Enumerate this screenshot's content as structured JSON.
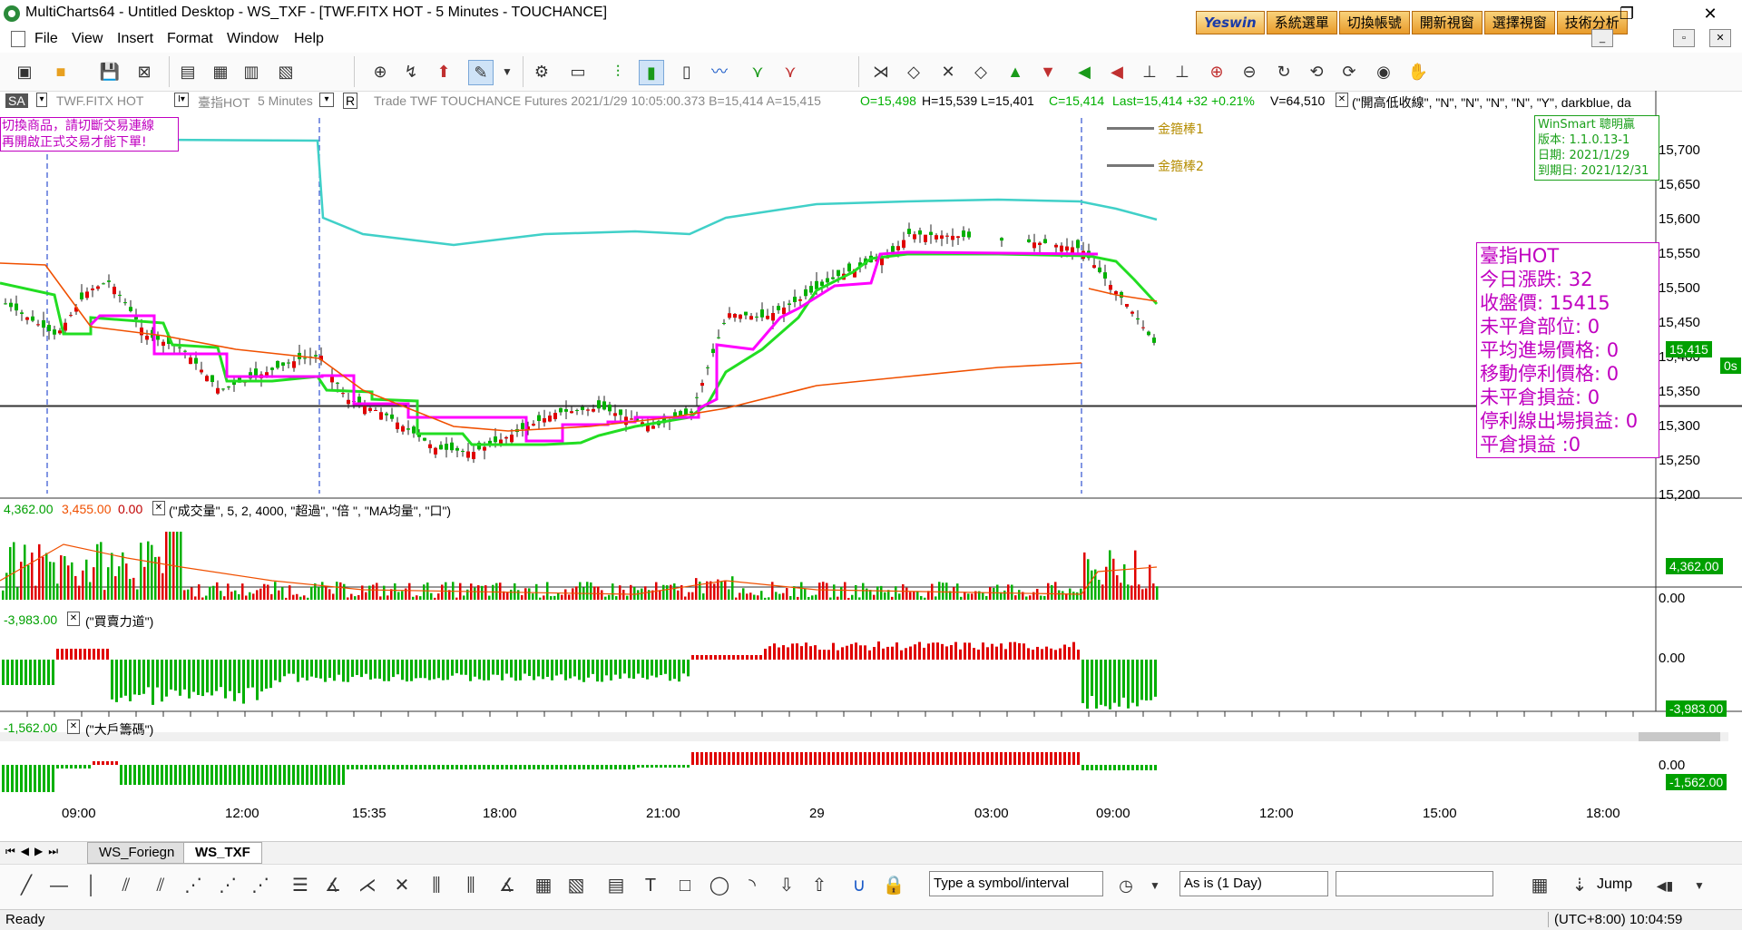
{
  "window": {
    "title": "MultiCharts64 - Untitled Desktop - WS_TXF - [TWF.FITX HOT - 5 Minutes - TOUCHANCE]",
    "min": "─",
    "restore": "❐",
    "close": "✕"
  },
  "yeswin": {
    "logo": "Yeswin",
    "buttons": [
      "系統選單",
      "切換帳號",
      "開新視窗",
      "選擇視窗",
      "技術分析"
    ]
  },
  "menu": [
    "File",
    "View",
    "Insert",
    "Format",
    "Window",
    "Help"
  ],
  "chart_header": {
    "sa": "SA",
    "symbol": "TWF.FITX HOT",
    "name": "臺指HOT",
    "interval": "5 Minutes",
    "mode": "R",
    "text": "Trade  TWF  TOUCHANCE  Futures  2021/1/29  10:05:00.373  B=15,414  A=15,415",
    "o": "O=15,498",
    "hl": "H=15,539  L=15,401",
    "c": "C=15,414",
    "last": "Last=15,414  +32  +0.21%",
    "v": "V=64,510",
    "study": "(\"開高低收線\", \"N\", \"N\", \"N\", \"N\", \"Y\", darkblue, da"
  },
  "notice": [
    "切換商品，請切斷交易連線",
    "再開啟正式交易才能下單!"
  ],
  "legend": [
    "金箍棒1",
    "金箍棒2"
  ],
  "winsmart": [
    "WinSmart 聰明贏",
    "版本: 1.1.0.13-1",
    "日期: 2021/1/29",
    "到期日: 2021/12/31"
  ],
  "infobox": [
    "臺指HOT",
    "今日漲跌: 32",
    "收盤價: 15415",
    "未平倉部位: 0",
    "平均進場價格: 0",
    "移動停利價格: 0",
    "未平倉損益: 0",
    "停利線出場損益: 0",
    "平倉損益 :0"
  ],
  "price_axis": [
    "15,700",
    "15,650",
    "15,600",
    "15,550",
    "15,500",
    "15,450",
    "15,400",
    "15,350",
    "15,300",
    "15,250",
    "15,200"
  ],
  "price_tag": "15,415",
  "price_tag2": "0s",
  "panel2": {
    "vals": [
      "4,362.00",
      "3,455.00",
      "0.00"
    ],
    "study": "(\"成交量\",  5,  2,  4000,  \"超過\",  \"倍 \",  \"MA均量\",  \"口\")",
    "axis": "0.00",
    "tag": "4,362.00"
  },
  "panel3": {
    "val": "-3,983.00",
    "study": "(\"買賣力道\")",
    "axis": "0.00",
    "tag": "-3,983.00"
  },
  "panel4": {
    "val": "-1,562.00",
    "study": "(\"大戶籌碼\")",
    "axis": "0.00",
    "tag": "-1,562.00"
  },
  "time_axis": [
    "09:00",
    "12:00",
    "15:35",
    "18:00",
    "21:00",
    "29",
    "03:00",
    "09:00",
    "12:00",
    "15:00",
    "18:00"
  ],
  "tabs": [
    "WS_Foriegn",
    "WS_TXF"
  ],
  "drawbar": {
    "symbol_input": "Type a symbol/interval",
    "resolution": "As is (1 Day)",
    "jump": "Jump"
  },
  "status": {
    "ready": "Ready",
    "time": "(UTC+8:00) 10:04:59"
  },
  "colors": {
    "green": "#00b000",
    "red": "#e00000",
    "cyan": "#40d0c8",
    "magenta": "#ff00ff",
    "orange": "#f05000",
    "lime": "#22dd22"
  }
}
